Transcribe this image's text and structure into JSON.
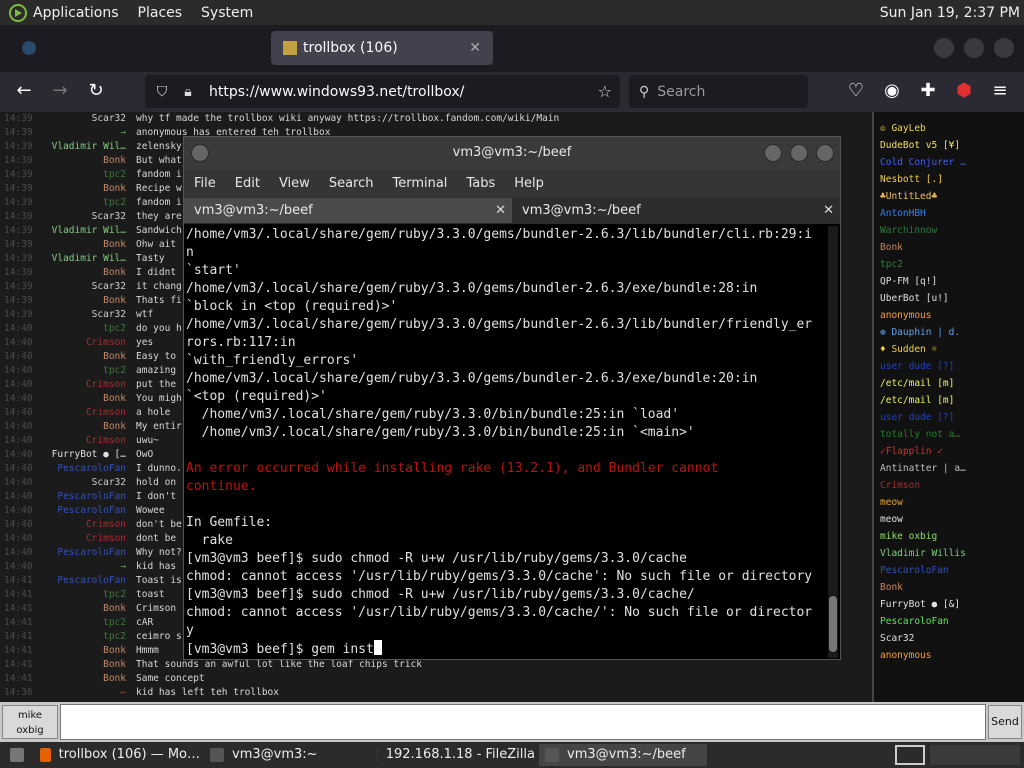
{
  "panel": {
    "menus": [
      "Applications",
      "Places",
      "System"
    ],
    "clock": "Sun Jan 19,  2:37 PM"
  },
  "browser": {
    "tabs": [
      {
        "label": "trollbox (106)",
        "close": "✕"
      }
    ],
    "url": "https://www.windows93.net/trollbox/",
    "search_placeholder": "Search"
  },
  "chat": {
    "rows": [
      {
        "time": "14:39",
        "nick": "Scar32",
        "color": "#d0d0d0",
        "msg": "why tf made the trollbox wiki anyway https://trollbox.fandom.com/wiki/Main"
      },
      {
        "time": "14:39",
        "nick": "→",
        "color": "#5fae3a",
        "msg": "anonymous has entered teh trollbox"
      },
      {
        "time": "14:39",
        "nick": "Vladimir Wil…",
        "color": "#7fd07f",
        "msg": "zelensky"
      },
      {
        "time": "14:39",
        "nick": "Bonk",
        "color": "#c88860",
        "msg": "But what"
      },
      {
        "time": "14:39",
        "nick": "tpc2",
        "color": "#3a7a3a",
        "msg": "fandom i"
      },
      {
        "time": "14:39",
        "nick": "Bonk",
        "color": "#c88860",
        "msg": "Recipe w"
      },
      {
        "time": "14:39",
        "nick": "tpc2",
        "color": "#3a7a3a",
        "msg": "fandom i"
      },
      {
        "time": "14:39",
        "nick": "Scar32",
        "color": "#d0d0d0",
        "msg": "they are"
      },
      {
        "time": "14:39",
        "nick": "Vladimir Wil…",
        "color": "#7fd07f",
        "msg": "Sandwich"
      },
      {
        "time": "14:39",
        "nick": "Bonk",
        "color": "#c88860",
        "msg": "Ohw ait"
      },
      {
        "time": "14:39",
        "nick": "Vladimir Wil…",
        "color": "#7fd07f",
        "msg": "Tasty"
      },
      {
        "time": "14:39",
        "nick": "Bonk",
        "color": "#c88860",
        "msg": "I didnt"
      },
      {
        "time": "14:39",
        "nick": "Scar32",
        "color": "#d0d0d0",
        "msg": "it chang"
      },
      {
        "time": "14:39",
        "nick": "Bonk",
        "color": "#c88860",
        "msg": "Thats fi"
      },
      {
        "time": "14:39",
        "nick": "Scar32",
        "color": "#d0d0d0",
        "msg": "wtf"
      },
      {
        "time": "14:40",
        "nick": "tpc2",
        "color": "#3a7a3a",
        "msg": "do you h"
      },
      {
        "time": "14:40",
        "nick": "Crimson",
        "color": "#a03030",
        "msg": "yes"
      },
      {
        "time": "14:40",
        "nick": "Bonk",
        "color": "#c88860",
        "msg": "Easy to"
      },
      {
        "time": "14:40",
        "nick": "tpc2",
        "color": "#3a7a3a",
        "msg": "amazing"
      },
      {
        "time": "14:40",
        "nick": "Crimson",
        "color": "#a03030",
        "msg": "put the"
      },
      {
        "time": "14:40",
        "nick": "Bonk",
        "color": "#c88860",
        "msg": "You migh"
      },
      {
        "time": "14:40",
        "nick": "Crimson",
        "color": "#a03030",
        "msg": "a hole"
      },
      {
        "time": "14:40",
        "nick": "Bonk",
        "color": "#c88860",
        "msg": "My entir"
      },
      {
        "time": "14:40",
        "nick": "Crimson",
        "color": "#a03030",
        "msg": "uwu~"
      },
      {
        "time": "14:40",
        "nick": "FurryBot ● […",
        "color": "#e0e0e0",
        "msg": "OwO"
      },
      {
        "time": "14:40",
        "nick": "PescaroloFan",
        "color": "#3050c0",
        "msg": "I dunno."
      },
      {
        "time": "14:40",
        "nick": "Scar32",
        "color": "#d0d0d0",
        "msg": "hold on"
      },
      {
        "time": "14:40",
        "nick": "PescaroloFan",
        "color": "#3050c0",
        "msg": "I don't"
      },
      {
        "time": "14:40",
        "nick": "PescaroloFan",
        "color": "#3050c0",
        "msg": "Wowee"
      },
      {
        "time": "14:40",
        "nick": "Crimson",
        "color": "#a03030",
        "msg": "don't be"
      },
      {
        "time": "14:40",
        "nick": "Crimson",
        "color": "#a03030",
        "msg": "dont be"
      },
      {
        "time": "14:40",
        "nick": "PescaroloFan",
        "color": "#3050c0",
        "msg": "Why not?"
      },
      {
        "time": "14:40",
        "nick": "→",
        "color": "#5fae3a",
        "msg": "kid has"
      },
      {
        "time": "14:41",
        "nick": "PescaroloFan",
        "color": "#3050c0",
        "msg": "Toast is"
      },
      {
        "time": "14:41",
        "nick": "tpc2",
        "color": "#3a7a3a",
        "msg": "toast"
      },
      {
        "time": "14:41",
        "nick": "Bonk",
        "color": "#c88860",
        "msg": "Crimson"
      },
      {
        "time": "14:41",
        "nick": "tpc2",
        "color": "#3a7a3a",
        "msg": "cAR"
      },
      {
        "time": "14:41",
        "nick": "tpc2",
        "color": "#3a7a3a",
        "msg": "ceimro s"
      },
      {
        "time": "14:41",
        "nick": "Bonk",
        "color": "#c88860",
        "msg": "Hmmm"
      },
      {
        "time": "14:41",
        "nick": "Bonk",
        "color": "#c88860",
        "msg": "That sounds an awful lot like the loaf chips trick"
      },
      {
        "time": "14:41",
        "nick": "Bonk",
        "color": "#c88860",
        "msg": "Same concept"
      },
      {
        "time": "14:36",
        "nick": "←",
        "color": "#c03030",
        "msg": "kid has left teh trollbox"
      }
    ],
    "users": [
      {
        "name": "♔ GayLeb",
        "color": "#f0d060"
      },
      {
        "name": "DudeBot v5 [¥]",
        "color": "#f0e060"
      },
      {
        "name": "Cold Conjurer …",
        "color": "#4060f0"
      },
      {
        "name": "Nesbott [.]",
        "color": "#f0d040"
      },
      {
        "name": "♣UntitLed♣",
        "color": "#f0c060"
      },
      {
        "name": "AntonHBH",
        "color": "#3080f0"
      },
      {
        "name": "Warchinnow",
        "color": "#2a7a3a"
      },
      {
        "name": "Bonk",
        "color": "#c88860"
      },
      {
        "name": "tpc2",
        "color": "#3a7a3a"
      },
      {
        "name": "QP-FM [q!]",
        "color": "#e0e0e0"
      },
      {
        "name": "UberBot [u!]",
        "color": "#e0e0e0"
      },
      {
        "name": "anonymous",
        "color": "#f0a030"
      },
      {
        "name": "❁ Dauphin | d.",
        "color": "#60a0f0"
      },
      {
        "name": "♦ Sudden ☼",
        "color": "#f0d040"
      },
      {
        "name": "user dude [?]",
        "color": "#2040c0"
      },
      {
        "name": "/etc/mail [m]",
        "color": "#f0f060"
      },
      {
        "name": "/etc/mail [m]",
        "color": "#f0f060"
      },
      {
        "name": "user dude [?]",
        "color": "#2040c0"
      },
      {
        "name": "totally not a…",
        "color": "#208020"
      },
      {
        "name": "✓Flapplin ✓",
        "color": "#d03030"
      },
      {
        "name": "Antinatter | a…",
        "color": "#c0c0c0"
      },
      {
        "name": "Crimson",
        "color": "#a03030"
      },
      {
        "name": "meow",
        "color": "#f0a030"
      },
      {
        "name": "meow",
        "color": "#e0e0e0"
      },
      {
        "name": "mike oxbig",
        "color": "#90e060"
      },
      {
        "name": "Vladimir Willis",
        "color": "#7fd07f"
      },
      {
        "name": "PescaroloFan",
        "color": "#3050c0"
      },
      {
        "name": "Bonk",
        "color": "#c88860"
      },
      {
        "name": "FurryBot ● [&]",
        "color": "#e0e0e0"
      },
      {
        "name": "PescaroloFan",
        "color": "#60e060"
      },
      {
        "name": "Scar32",
        "color": "#e0e0e0"
      },
      {
        "name": "anonymous",
        "color": "#f0a030"
      }
    ],
    "nick_line1": "mike",
    "nick_line2": "oxbig",
    "send_label": "Send"
  },
  "terminal": {
    "title": "vm3@vm3:~/beef",
    "menu": [
      "File",
      "Edit",
      "View",
      "Search",
      "Terminal",
      "Tabs",
      "Help"
    ],
    "tabs": [
      {
        "label": "vm3@vm3:~/beef",
        "close": "✕"
      },
      {
        "label": "vm3@vm3:~/beef",
        "close": "✕"
      }
    ],
    "lines": [
      {
        "text": "/home/vm3/.local/share/gem/ruby/3.3.0/gems/bundler-2.6.3/lib/bundler/cli.rb:29:i",
        "err": false
      },
      {
        "text": "n",
        "err": false
      },
      {
        "text": "`start'",
        "err": false
      },
      {
        "text": "/home/vm3/.local/share/gem/ruby/3.3.0/gems/bundler-2.6.3/exe/bundle:28:in",
        "err": false
      },
      {
        "text": "`block in <top (required)>'",
        "err": false
      },
      {
        "text": "/home/vm3/.local/share/gem/ruby/3.3.0/gems/bundler-2.6.3/lib/bundler/friendly_er",
        "err": false
      },
      {
        "text": "rors.rb:117:in",
        "err": false
      },
      {
        "text": "`with_friendly_errors'",
        "err": false
      },
      {
        "text": "/home/vm3/.local/share/gem/ruby/3.3.0/gems/bundler-2.6.3/exe/bundle:20:in",
        "err": false
      },
      {
        "text": "`<top (required)>'",
        "err": false
      },
      {
        "text": "  /home/vm3/.local/share/gem/ruby/3.3.0/bin/bundle:25:in `load'",
        "err": false
      },
      {
        "text": "  /home/vm3/.local/share/gem/ruby/3.3.0/bin/bundle:25:in `<main>'",
        "err": false
      },
      {
        "text": "",
        "err": false
      },
      {
        "text": "An error occurred while installing rake (13.2.1), and Bundler cannot",
        "err": true
      },
      {
        "text": "continue.",
        "err": true
      },
      {
        "text": "",
        "err": false
      },
      {
        "text": "In Gemfile:",
        "err": false
      },
      {
        "text": "  rake",
        "err": false
      },
      {
        "text": "[vm3@vm3 beef]$ sudo chmod -R u+w /usr/lib/ruby/gems/3.3.0/cache",
        "err": false
      },
      {
        "text": "chmod: cannot access '/usr/lib/ruby/gems/3.3.0/cache': No such file or directory",
        "err": false
      },
      {
        "text": "[vm3@vm3 beef]$ sudo chmod -R u+w /usr/lib/ruby/gems/3.3.0/cache/",
        "err": false
      },
      {
        "text": "chmod: cannot access '/usr/lib/ruby/gems/3.3.0/cache/': No such file or director",
        "err": false
      },
      {
        "text": "y",
        "err": false
      }
    ],
    "prompt": "[vm3@vm3 beef]$ gem inst"
  },
  "taskbar": {
    "items": [
      {
        "label": "trollbox (106) — Mo…",
        "icon_color": "#e66000"
      },
      {
        "label": "vm3@vm3:~",
        "icon_color": "#555555"
      },
      {
        "label": "192.168.1.18 - FileZilla",
        "icon_color": "#bf0000"
      },
      {
        "label": "vm3@vm3:~/beef",
        "icon_color": "#555555"
      }
    ]
  }
}
